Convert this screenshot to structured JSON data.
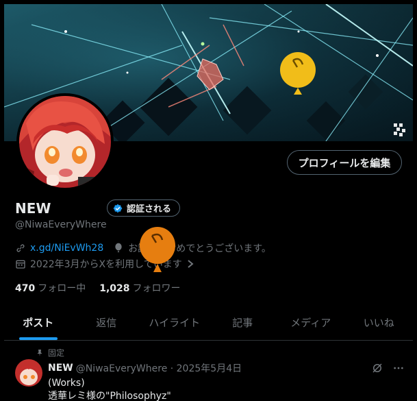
{
  "profile": {
    "name": "NEW",
    "verify_label": "認証される",
    "handle": "@NiwaEveryWhere",
    "link": "x.gd/NiEvWh28",
    "birthday": "お誕生日おめでとうございます。",
    "joined": "2022年3月からXを利用しています",
    "edit_label": "プロフィールを編集",
    "following_count": "470",
    "following_label": "フォロー中",
    "followers_count": "1,028",
    "followers_label": "フォロワー"
  },
  "tabs": [
    {
      "label": "ポスト"
    },
    {
      "label": "返信"
    },
    {
      "label": "ハイライト"
    },
    {
      "label": "記事"
    },
    {
      "label": "メディア"
    },
    {
      "label": "いいね"
    }
  ],
  "post": {
    "pinned_label": "固定",
    "name": "NEW",
    "handle_date": "@NiwaEveryWhere · 2025年5月4日",
    "line1": "(Works)",
    "line2": "透華レミ様の\"Philosophyz\""
  },
  "colors": {
    "accent": "#1d9bf0",
    "balloon_yellow": "#f1bd19",
    "balloon_orange": "#e67e10"
  }
}
